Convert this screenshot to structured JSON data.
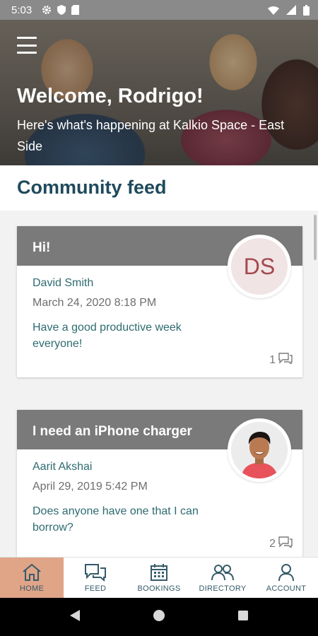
{
  "status_bar": {
    "time": "5:03",
    "icons_left": [
      "gear-icon",
      "shield-icon",
      "sd-card-icon"
    ],
    "icons_right": [
      "wifi-icon",
      "signal-icon",
      "battery-icon"
    ]
  },
  "hero": {
    "title": "Welcome, Rodrigo!",
    "subtitle": "Here's what's happening at Kalkio Space - East Side"
  },
  "feed": {
    "heading": "Community feed",
    "posts": [
      {
        "title": "Hi!",
        "author": "David Smith",
        "date": "March 24, 2020 8:18 PM",
        "message": "Have a good productive week everyone!",
        "comments": "1",
        "avatar_initials": "DS"
      },
      {
        "title": "I need an iPhone charger",
        "author": "Aarit Akshai",
        "date": "April 29, 2019 5:42 PM",
        "message": "Does anyone have one that I can borrow?",
        "comments": "2",
        "avatar_initials": ""
      }
    ]
  },
  "bottom_nav": {
    "items": [
      {
        "label": "HOME",
        "icon": "home-icon",
        "active": true
      },
      {
        "label": "FEED",
        "icon": "chat-icon",
        "active": false
      },
      {
        "label": "BOOKINGS",
        "icon": "calendar-icon",
        "active": false
      },
      {
        "label": "DIRECTORY",
        "icon": "people-icon",
        "active": false
      },
      {
        "label": "ACCOUNT",
        "icon": "person-icon",
        "active": false
      }
    ]
  },
  "colors": {
    "accent": "#e0a487",
    "heading": "#1f4a5c",
    "teal_text": "#2e6b70",
    "card_header": "#7a7a7a"
  }
}
